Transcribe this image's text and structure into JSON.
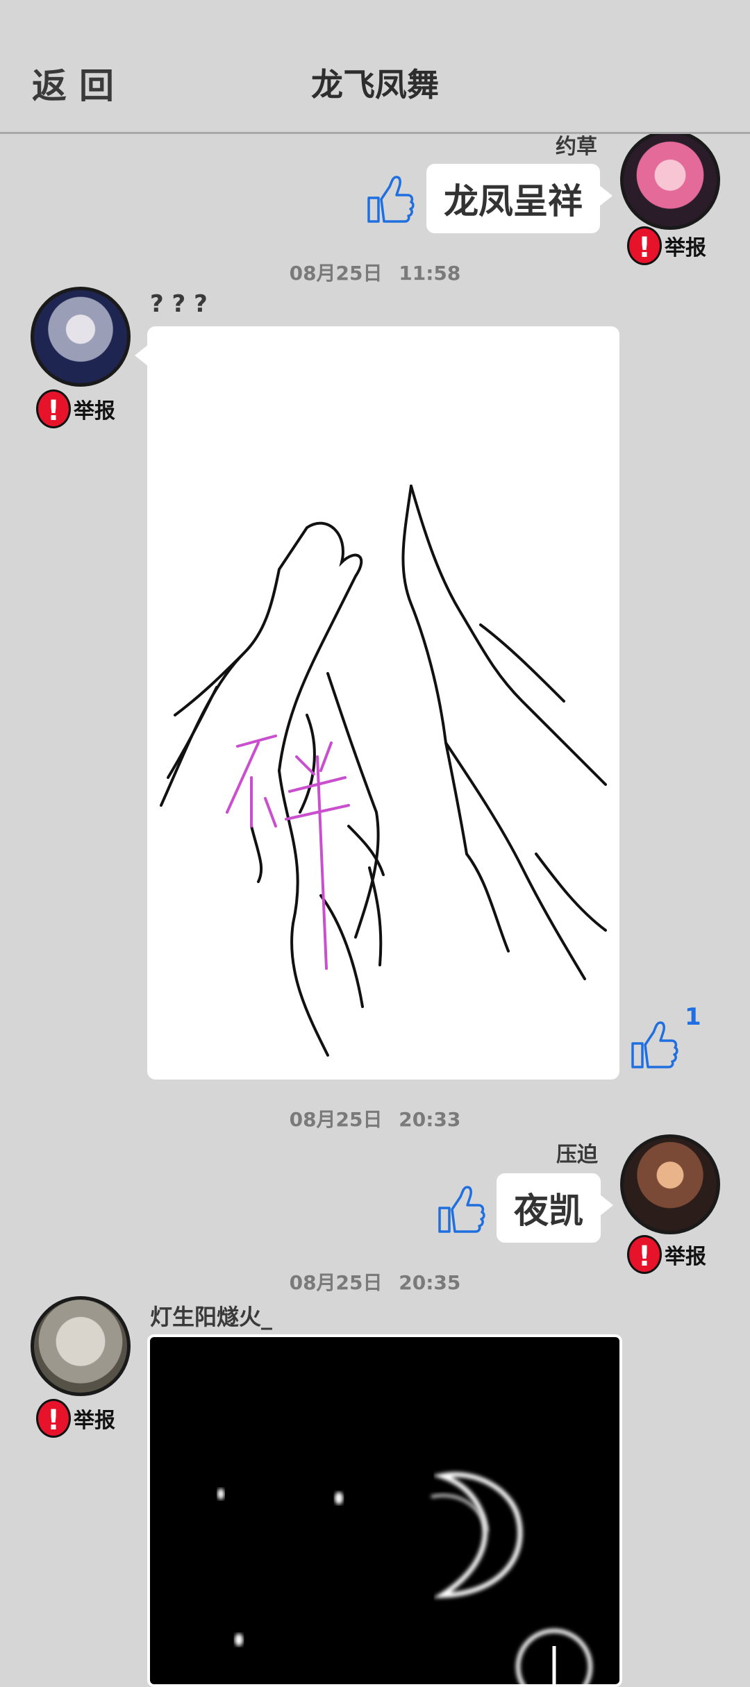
{
  "header": {
    "back_label": "返回",
    "title": "龙飞凤舞"
  },
  "report_label": "举报",
  "like_count": "1",
  "messages": [
    {
      "id": "m1",
      "side": "right",
      "nickname": "约草",
      "text": "龙凤呈祥"
    },
    {
      "id": "m2",
      "side": "left",
      "timestamp": "08月25日 11:58",
      "nickname": "? ? ?",
      "type": "image"
    },
    {
      "id": "m3",
      "side": "right",
      "timestamp": "08月25日 20:33",
      "nickname": "压迫",
      "text": "夜凯"
    },
    {
      "id": "m4",
      "side": "left",
      "timestamp": "08月25日 20:35",
      "nickname": "灯生阳燧火_",
      "type": "image"
    }
  ],
  "colors": {
    "background": "#d6d6d6",
    "like_blue": "#1f6fe0",
    "report_red": "#e6132a",
    "drawing_magenta": "#c94fcf"
  }
}
